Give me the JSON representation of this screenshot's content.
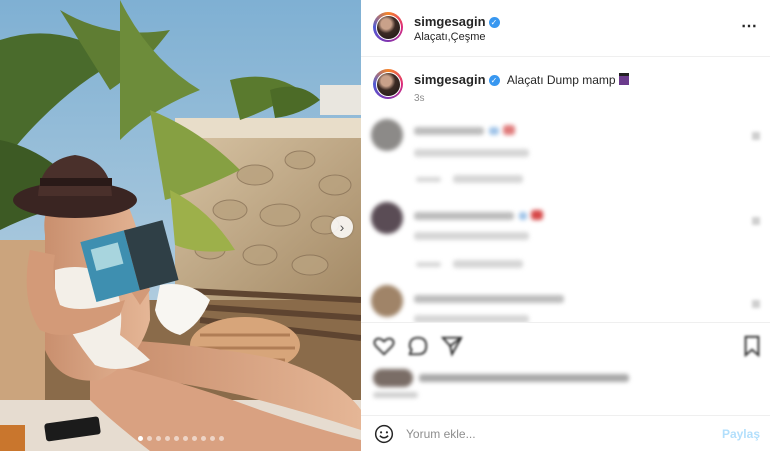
{
  "post": {
    "username": "simgesagin",
    "location": "Alaçatı,Çeşme",
    "more_icon": "⋯",
    "caption": "Alaçatı Dump mamp",
    "time": "3s",
    "carousel_next": "›"
  },
  "composer": {
    "placeholder": "Yorum ekle...",
    "share_label": "Paylaş"
  },
  "colors": {
    "verified": "#3897f0",
    "share_disabled": "#b2dffc",
    "story_ring": [
      "#f58529",
      "#dd2a7b",
      "#8134af",
      "#515bd4"
    ]
  },
  "icons": [
    "verified-icon",
    "more-options-icon",
    "heart-icon",
    "comment-icon",
    "share-icon",
    "bookmark-icon",
    "emoji-icon",
    "chevron-right-icon"
  ],
  "carousel": {
    "count": 10,
    "active": 1
  }
}
